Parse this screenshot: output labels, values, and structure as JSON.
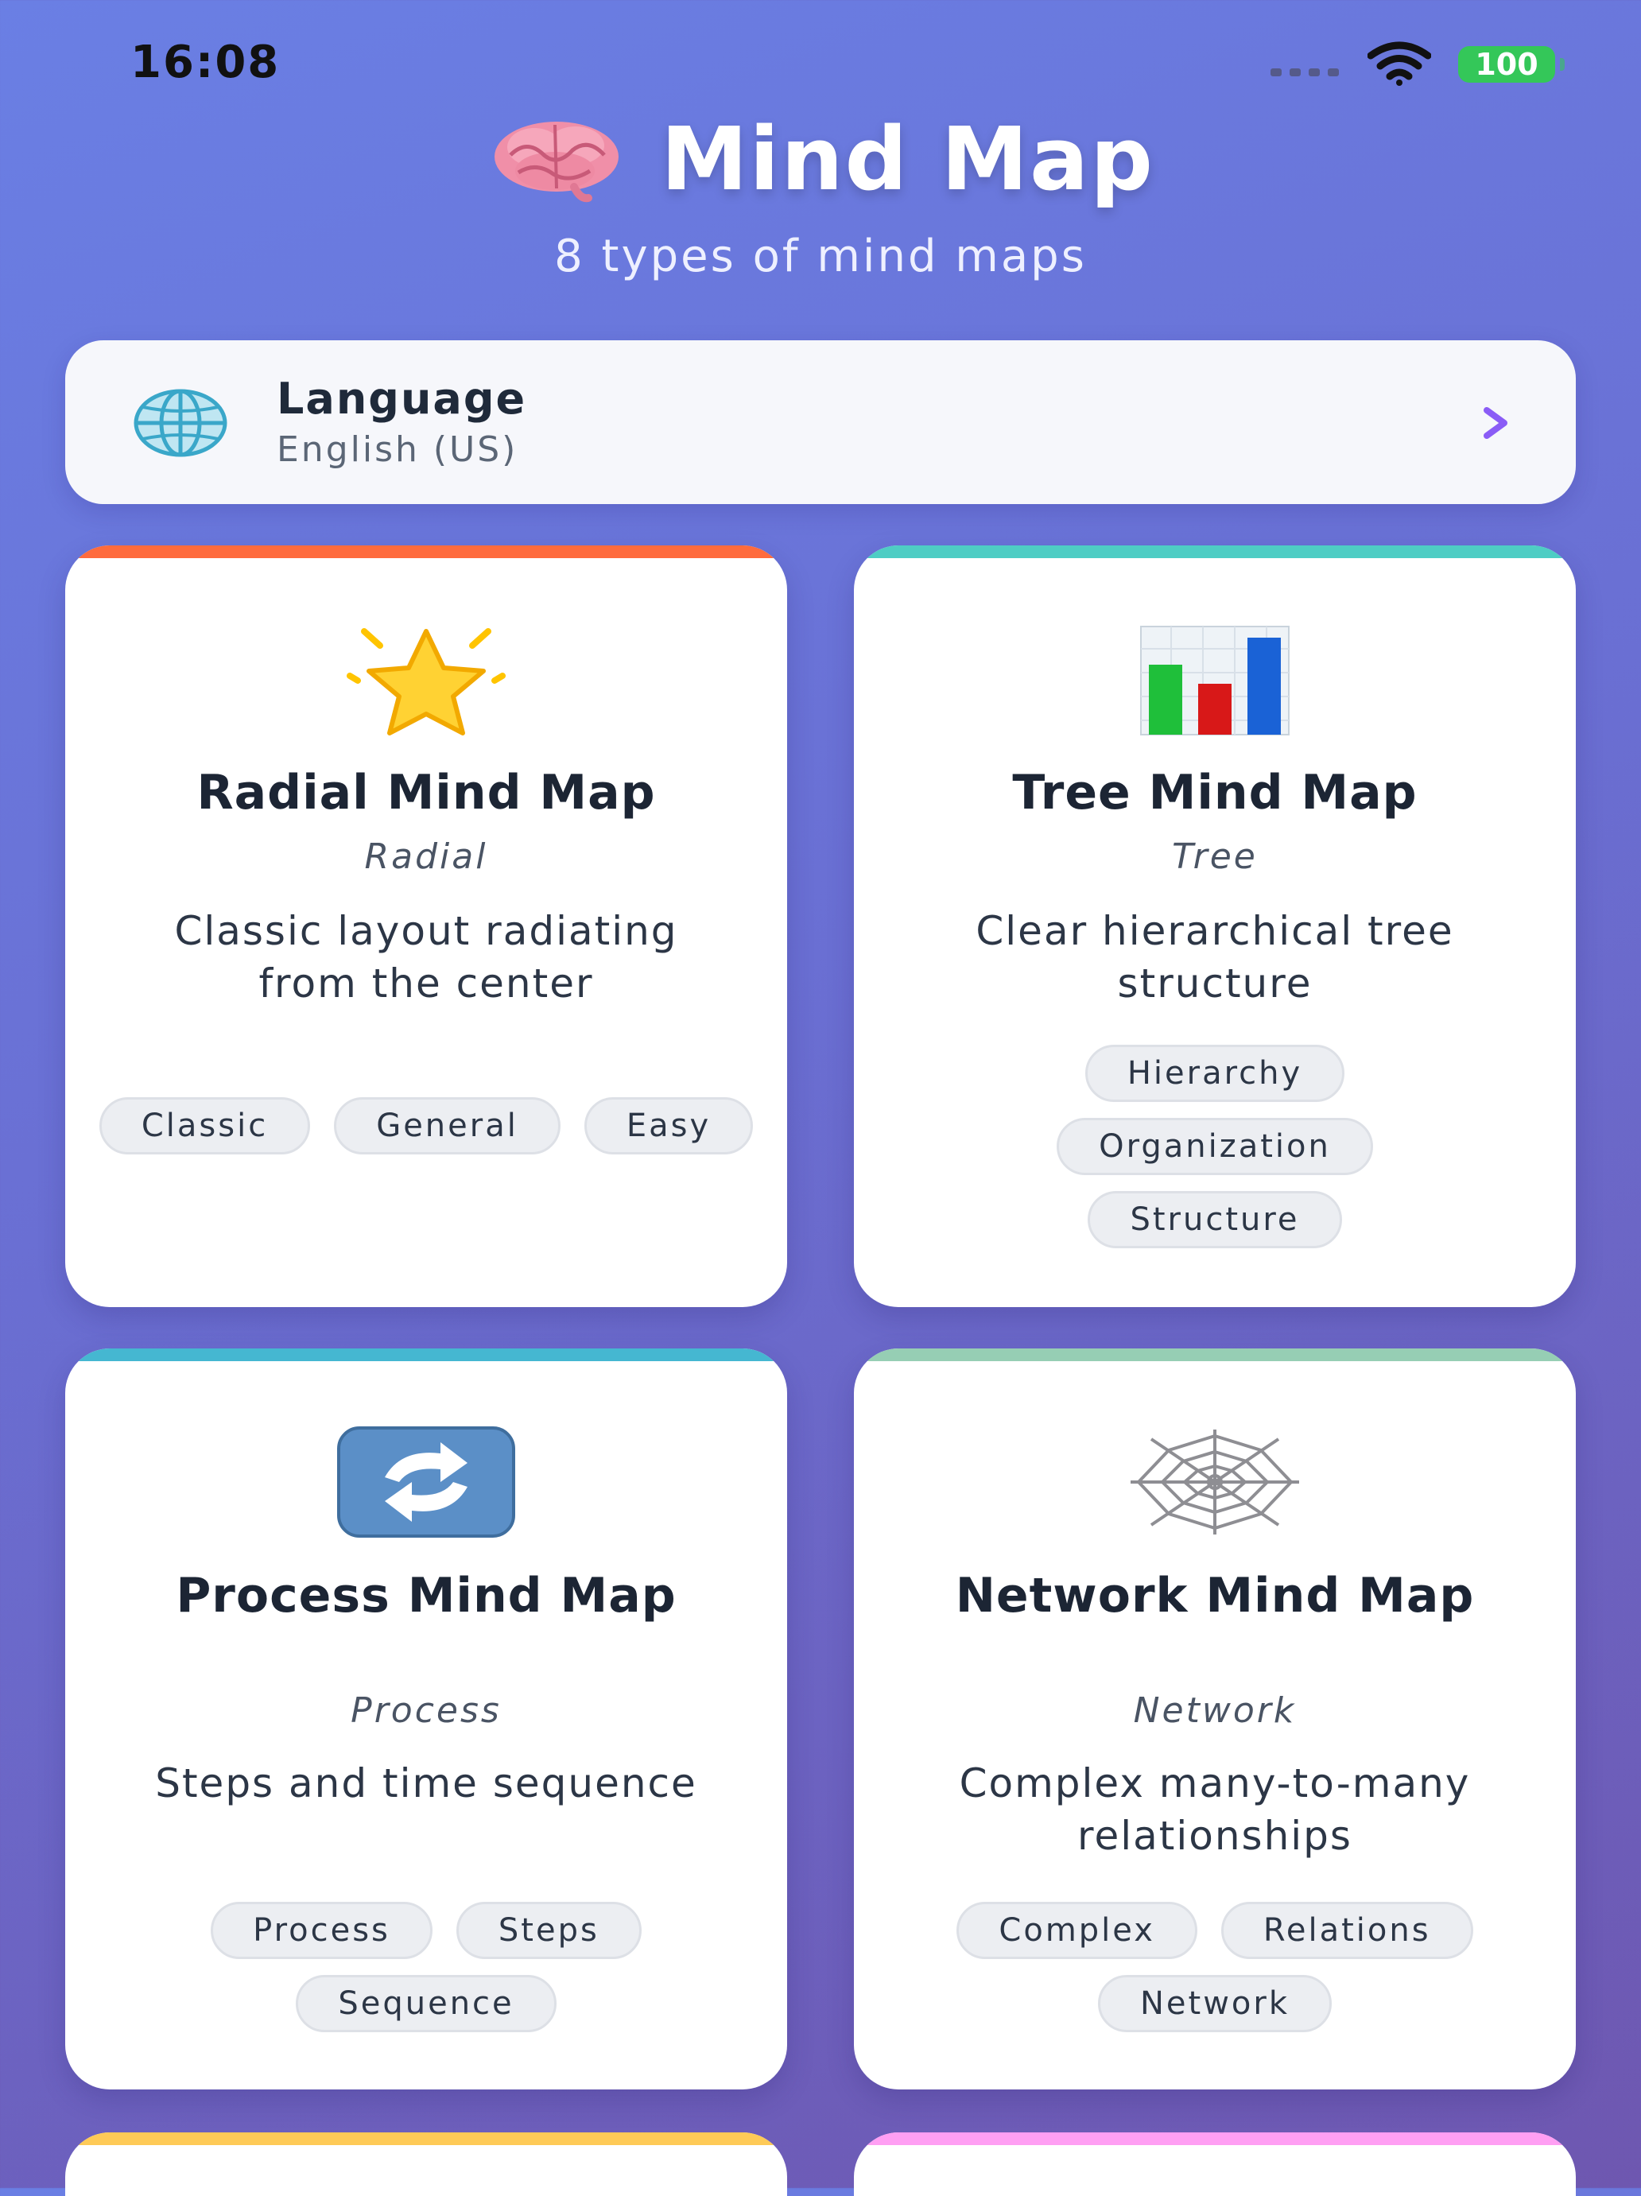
{
  "status_bar": {
    "time": "16:08",
    "battery": "100"
  },
  "header": {
    "title": "Mind Map",
    "subtitle": "8 types of mind maps",
    "icon": "brain-icon"
  },
  "language": {
    "label": "Language",
    "value": "English (US)",
    "icon": "globe-icon",
    "accent": "#8a5cf6"
  },
  "cards": [
    {
      "name": "Radial Mind Map",
      "type": "Radial",
      "description": "Classic layout radiating from the center",
      "icon": "star-icon",
      "accent": "#ff6b3d",
      "tags": [
        "Classic",
        "General",
        "Easy"
      ]
    },
    {
      "name": "Tree Mind Map",
      "type": "Tree",
      "description": "Clear hierarchical tree structure",
      "icon": "bar-chart-icon",
      "accent": "#4ecdc4",
      "tags": [
        "Hierarchy",
        "Organization",
        "Structure"
      ]
    },
    {
      "name": "Process Mind Map",
      "type": "Process",
      "description": "Steps and time sequence",
      "icon": "cycle-arrows-icon",
      "accent": "#45b7d1",
      "tags": [
        "Process",
        "Steps",
        "Sequence"
      ]
    },
    {
      "name": "Network Mind Map",
      "type": "Network",
      "description": "Complex many-to-many relationships",
      "icon": "spider-web-icon",
      "accent": "#96ceb4",
      "tags": [
        "Complex",
        "Relations",
        "Network"
      ]
    }
  ],
  "partial_cards": [
    {
      "accent": "#feca57"
    },
    {
      "accent": "#ff9ff3"
    }
  ]
}
